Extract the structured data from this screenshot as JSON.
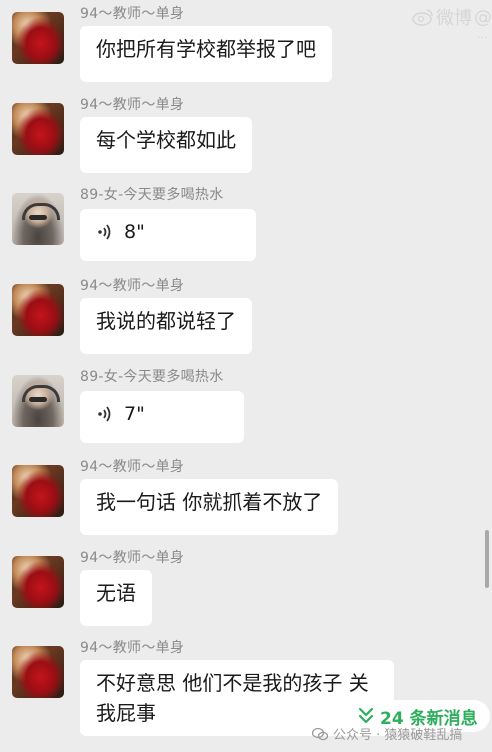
{
  "watermark": {
    "brand": "微博",
    "brand_suffix": "@",
    "account_suffix": "…"
  },
  "messages": [
    {
      "sender": "94～教师～单身",
      "text": "你把所有学校都举报了吧"
    },
    {
      "sender": "94～教师～单身",
      "text": "每个学校都如此"
    },
    {
      "sender": "89-女-今天要多喝热水",
      "voice_duration": "8\""
    },
    {
      "sender": "94～教师～单身",
      "text": "我说的都说轻了"
    },
    {
      "sender": "89-女-今天要多喝热水",
      "voice_duration": "7\""
    },
    {
      "sender": "94～教师～单身",
      "text": "我一句话 你就抓着不放了"
    },
    {
      "sender": "94～教师～单身",
      "text": "无语"
    },
    {
      "sender": "94～教师～单身",
      "text": "不好意思 他们不是我的孩子 关我屁事"
    }
  ],
  "new_messages": {
    "label": "24 条新消息"
  },
  "footer": {
    "text": "公众号 · 猿猿破鞋乱搞"
  },
  "colors": {
    "accent": "#2fae5e",
    "bubble": "#ffffff",
    "background": "#ececec"
  }
}
